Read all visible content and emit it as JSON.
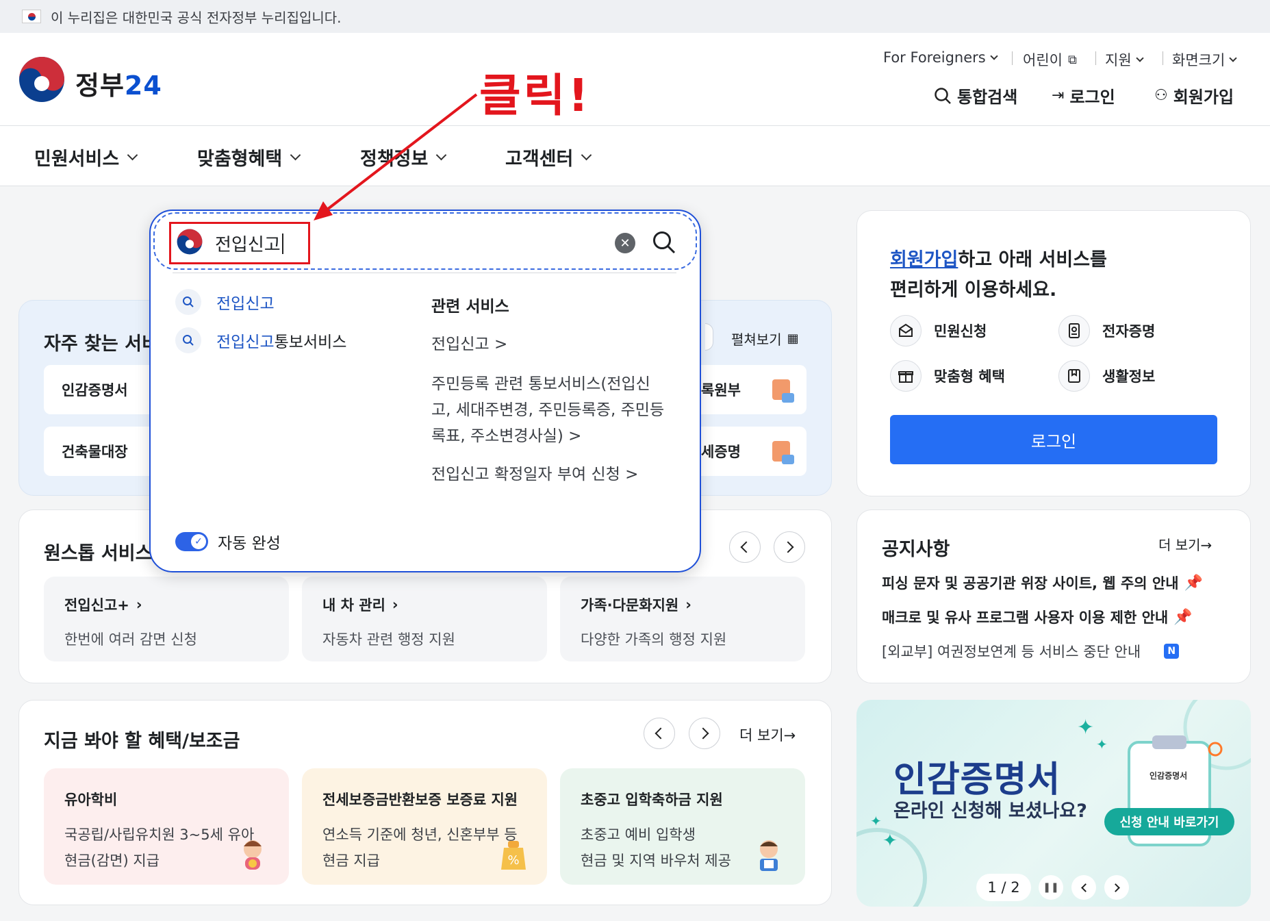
{
  "banner": {
    "text": "이 누리집은 대한민국 공식 전자정부 누리집입니다."
  },
  "header": {
    "logo_text": "정부",
    "logo_num": "24",
    "util": [
      "For Foreigners",
      "어린이",
      "지원",
      "화면크기"
    ],
    "actions": [
      "통합검색",
      "로그인",
      "회원가입"
    ]
  },
  "gnb": [
    "민원서비스",
    "맞춤형혜택",
    "정책정보",
    "고객센터"
  ],
  "annotation": {
    "click_label": "클릭!"
  },
  "search": {
    "value": "전입신고",
    "suggestions": [
      {
        "hl": "전입신고",
        "rest": ""
      },
      {
        "hl": "전입신고",
        "rest": "통보서비스"
      }
    ],
    "related_title": "관련 서비스",
    "related": [
      "전입신고 >",
      "주민등록 관련 통보서비스(전입신",
      "고, 세대주변경, 주민등록증, 주민등",
      "록표, 주소변경사실) >",
      "전입신고 확정일자 부여 신청 >"
    ],
    "autocomplete_label": "자동 완성"
  },
  "frequent": {
    "title": "자주 찾는 서비",
    "expand": "펼쳐보기",
    "items": [
      "인감증명서",
      "건축물대장",
      "록원부",
      "세증명"
    ]
  },
  "onestop": {
    "title": "원스톱 서비스",
    "items": [
      {
        "t": "전입신고+",
        "d": "한번에 여러 감면 신청"
      },
      {
        "t": "내 차 관리",
        "d": "자동차 관련 행정 지원"
      },
      {
        "t": "가족·다문화지원",
        "d": "다양한 가족의 행정 지원"
      }
    ]
  },
  "benefits": {
    "title": "지금 봐야 할 혜택/보조금",
    "more": "더 보기→",
    "items": [
      {
        "t": "유아학비",
        "d1": "국공립/사립유치원 3~5세 유아",
        "d2": "현금(감면) 지급",
        "bg": "#fdeeee"
      },
      {
        "t": "전세보증금반환보증 보증료 지원",
        "d1": "연소득 기준에 청년, 신혼부부 등",
        "d2": "현금 지급",
        "bg": "#fdf3e3"
      },
      {
        "t": "초중고 입학축하금 지원",
        "d1": "초중고 예비 입학생",
        "d2": "현금 및 지역 바우처 제공",
        "bg": "#eaf5ee"
      }
    ]
  },
  "member": {
    "link": "회원가입",
    "line1": "하고 아래 서비스를",
    "line2": "편리하게 이용하세요.",
    "icons": [
      "민원신청",
      "전자증명",
      "맞춤형 혜택",
      "생활정보"
    ],
    "login": "로그인"
  },
  "notice": {
    "title": "공지사항",
    "more": "더 보기→",
    "items": [
      "피싱 문자 및 공공기관 위장 사이트, 웹 주의 안내",
      "매크로 및 유사 프로그램 사용자 이용 제한 안내",
      "[외교부] 여권정보연계 등 서비스 중단 안내"
    ],
    "new_badge": "N"
  },
  "promo": {
    "title": "인감증명서",
    "sub": "온라인 신청해 보셨나요?",
    "btn": "신청 안내 바로가기",
    "doc": "인감증명서",
    "pager": "1 / 2"
  }
}
